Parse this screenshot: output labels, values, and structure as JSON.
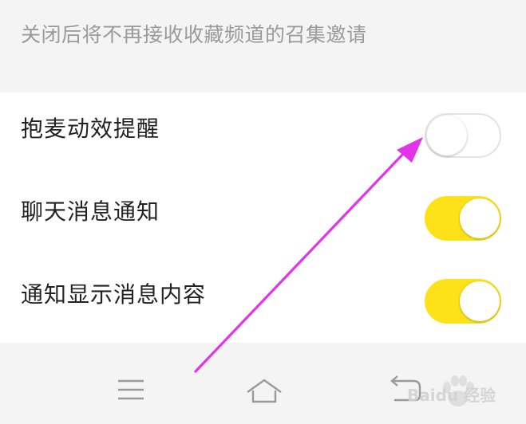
{
  "hint": {
    "text": "关闭后将不再接收收藏频道的召集邀请"
  },
  "settings": {
    "items": [
      {
        "label": "抱麦动效提醒",
        "enabled": false
      },
      {
        "label": "聊天消息通知",
        "enabled": true
      },
      {
        "label": "通知显示消息内容",
        "enabled": true
      }
    ]
  },
  "colors": {
    "toggle_on": "#fde21a",
    "toggle_off": "#ffffff",
    "arrow": "#e234e8",
    "background": "#f4f4f4"
  },
  "navbar": {
    "icons": [
      "menu-icon",
      "home-icon",
      "back-icon"
    ]
  },
  "watermark": {
    "text": "Baidu 经验"
  }
}
